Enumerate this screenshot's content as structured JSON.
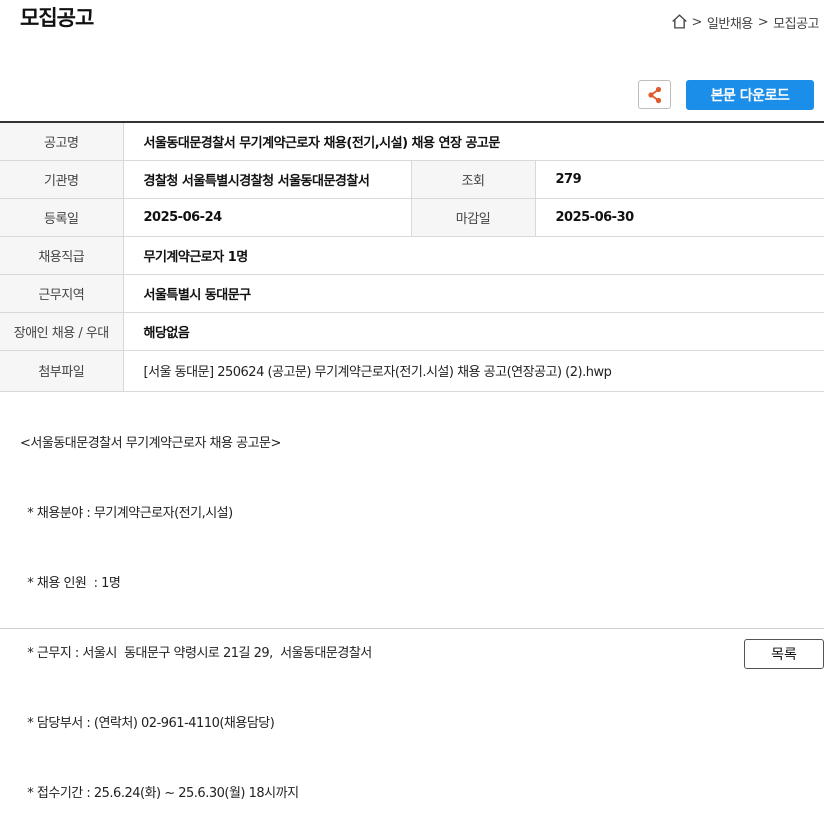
{
  "header": {
    "title": "모집공고",
    "breadcrumb": [
      ">",
      "일반채용",
      ">",
      "모집공고"
    ]
  },
  "actions": {
    "download_label": "본문 다운로드",
    "share_icon": "share-icon",
    "share_color": "#e05a2b",
    "download_color": "#1a8ee8"
  },
  "info": {
    "title_label": "공고명",
    "title_value": "서울동대문경찰서 무기계약근로자 채용(전기,시설) 채용 연장 공고문",
    "agency_label": "기관명",
    "agency_value": "경찰청 서울특별시경찰청 서울동대문경찰서",
    "views_label": "조회",
    "views_value": "279",
    "reg_label": "등록일",
    "reg_value": "2025-06-24",
    "deadline_label": "마감일",
    "deadline_value": "2025-06-30",
    "position_label": "채용직급",
    "position_value": "무기계약근로자 1명",
    "region_label": "근무지역",
    "region_value": "서울특별시 동대문구",
    "disability_label": "장애인 채용 / 우대",
    "disability_value": "해당없음",
    "attach_label": "첨부파일",
    "attach_value": "[서울 동대문] 250624 (공고문) 무기계약근로자(전기.시설) 채용 공고(연장공고) (2).hwp"
  },
  "body": {
    "lines": [
      "<서울동대문경찰서 무기계약근로자 채용 공고문>",
      "  * 채용분야 : 무기계약근로자(전기,시설)",
      "  * 채용 인원  : 1명",
      "  * 근무지 : 서울시  동대문구 약령시로 21길 29,  서울동대문경찰서",
      "  * 담당부서 : (연락처) 02-961-4110(채용담당)",
      "  * 접수기간 : 25.6.24(화) ~ 25.6.30(월) 18시까지"
    ]
  },
  "footer": {
    "list_label": "목록"
  }
}
